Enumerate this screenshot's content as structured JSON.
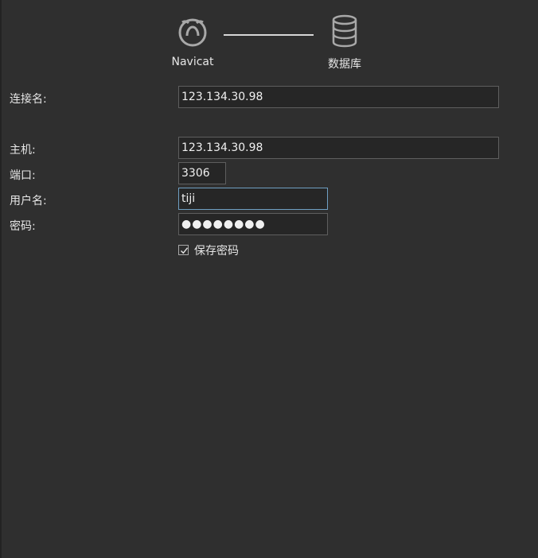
{
  "header": {
    "left_icon": "navicat-icon",
    "left_caption": "Navicat",
    "right_icon": "database-icon",
    "right_caption": "数据库"
  },
  "form": {
    "connection_name": {
      "label": "连接名:",
      "value": "123.134.30.98"
    },
    "host": {
      "label": "主机:",
      "value": "123.134.30.98"
    },
    "port": {
      "label": "端口:",
      "value": "3306"
    },
    "username": {
      "label": "用户名:",
      "value": "tiji"
    },
    "password": {
      "label": "密码:",
      "value": "●●●●●●●●"
    },
    "save_password": {
      "label": "保存密码",
      "checked": true
    }
  }
}
